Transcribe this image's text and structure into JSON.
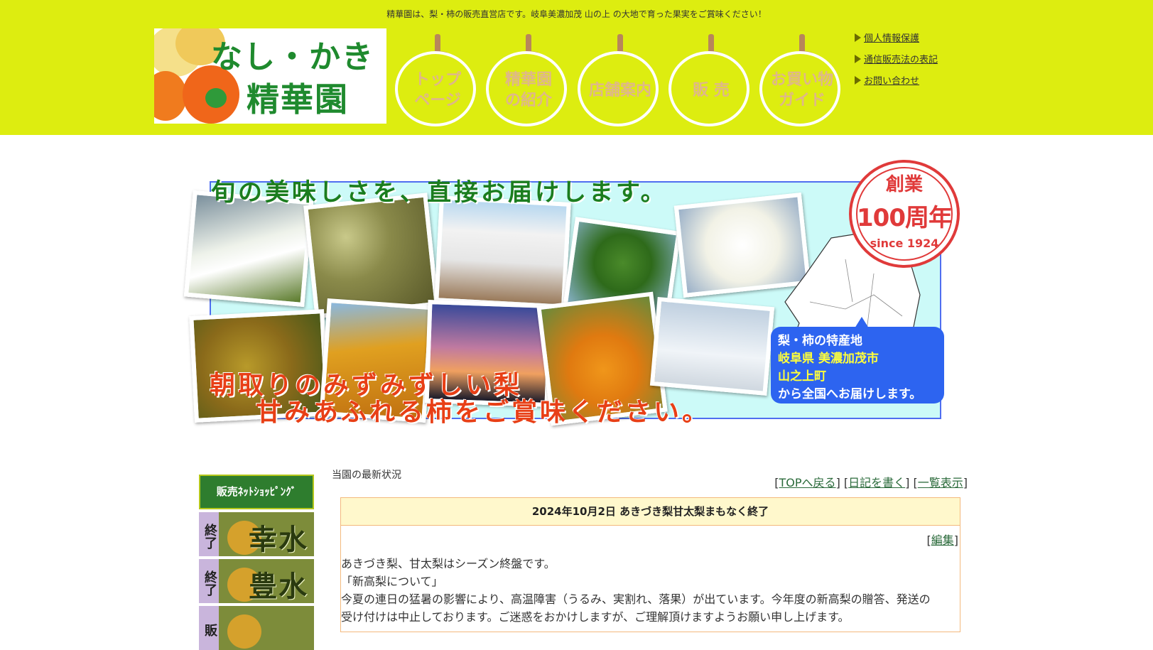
{
  "header": {
    "tagline": "精華園は、梨・柿の販売直営店です。岐阜美濃加茂 山の上 の大地で育った果実をご賞味ください！",
    "logo": {
      "line1": "なし・かき",
      "line2": "精華園"
    },
    "nav": [
      {
        "label": "トップ\nページ"
      },
      {
        "label": "精華園\nの紹介"
      },
      {
        "label": "店舗案内"
      },
      {
        "label": "販 売"
      },
      {
        "label": "お買い物\nガイド"
      }
    ],
    "links": [
      "個人情報保護",
      "通信販売法の表記",
      "お問い合わせ"
    ]
  },
  "banner": {
    "title": "旬の美味しさを、直接お届けします。",
    "slogan1": "朝取りのみずみずしい梨",
    "slogan2": "甘みあふれる柿をご賞味ください。",
    "seal": {
      "top": "創業",
      "mid": "100周年",
      "bottom": "since 1924"
    },
    "callout": {
      "l1": "梨・柿の特産地",
      "l2": "岐阜県 美濃加茂市",
      "l3": "山之上町",
      "l4": "から全国へお届けします。"
    }
  },
  "sidebar": {
    "shop_header": "販売ﾈｯﾄｼｮｯﾋﾟﾝｸﾞ",
    "items": [
      {
        "tag": "終了",
        "name": "幸水"
      },
      {
        "tag": "終了",
        "name": "豊水"
      },
      {
        "tag": "販",
        "name": ""
      }
    ]
  },
  "main": {
    "crumb": "当園の最新状況",
    "links": [
      "TOPへ戻る",
      "日記を書く",
      "一覧表示"
    ],
    "entry": {
      "title": "2024年10月2日 あきづき梨甘太梨まもなく終了",
      "edit": "編集",
      "lines": [
        "あきづき梨、甘太梨はシーズン終盤です。",
        "「新高梨について」",
        "今夏の連日の猛暑の影響により、高温障害（うるみ、実割れ、落果）が出ています。今年度の新高梨の贈答、発送の",
        "受け付けは中止しております。ご迷惑をおかけしますが、ご理解頂けますようお願い申し上げます。"
      ]
    }
  }
}
